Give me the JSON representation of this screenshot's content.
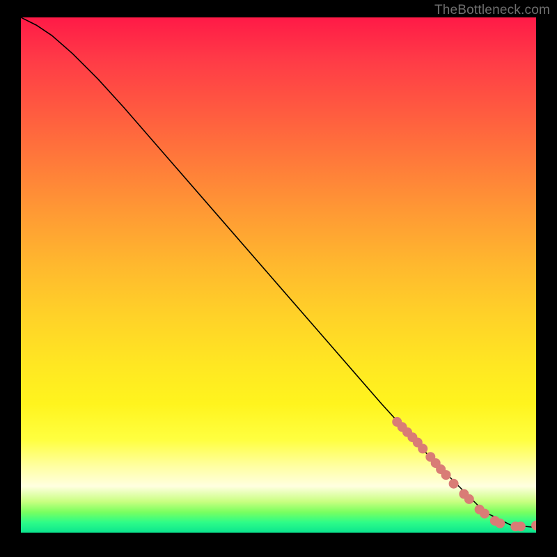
{
  "watermark": "TheBottleneck.com",
  "chart_data": {
    "type": "line",
    "title": "",
    "xlabel": "",
    "ylabel": "",
    "xlim": [
      0,
      100
    ],
    "ylim": [
      0,
      100
    ],
    "grid": false,
    "legend": false,
    "series": [
      {
        "name": "curve",
        "x": [
          0,
          3,
          6,
          10,
          15,
          20,
          30,
          40,
          50,
          60,
          70,
          80,
          90,
          95,
          100
        ],
        "y": [
          100,
          98.5,
          96.5,
          93,
          88,
          82.5,
          71,
          59.5,
          48,
          36.5,
          25,
          14,
          4,
          1.5,
          1
        ]
      }
    ],
    "points": [
      {
        "name": "cluster",
        "x": 73,
        "y": 21.5
      },
      {
        "name": "cluster",
        "x": 74,
        "y": 20.5
      },
      {
        "name": "cluster",
        "x": 75,
        "y": 19.5
      },
      {
        "name": "cluster",
        "x": 76,
        "y": 18.5
      },
      {
        "name": "cluster",
        "x": 77,
        "y": 17.5
      },
      {
        "name": "cluster",
        "x": 78,
        "y": 16.3
      },
      {
        "name": "cluster",
        "x": 79.5,
        "y": 14.7
      },
      {
        "name": "cluster",
        "x": 80.5,
        "y": 13.5
      },
      {
        "name": "cluster",
        "x": 81.5,
        "y": 12.3
      },
      {
        "name": "cluster",
        "x": 82.5,
        "y": 11.2
      },
      {
        "name": "cluster",
        "x": 84,
        "y": 9.5
      },
      {
        "name": "cluster",
        "x": 86,
        "y": 7.5
      },
      {
        "name": "cluster",
        "x": 87,
        "y": 6.5
      },
      {
        "name": "cluster",
        "x": 89,
        "y": 4.5
      },
      {
        "name": "cluster",
        "x": 90,
        "y": 3.7
      },
      {
        "name": "cluster",
        "x": 92,
        "y": 2.3
      },
      {
        "name": "cluster",
        "x": 93,
        "y": 1.8
      },
      {
        "name": "cluster",
        "x": 96,
        "y": 1.2
      },
      {
        "name": "cluster",
        "x": 97,
        "y": 1.2
      },
      {
        "name": "cluster",
        "x": 100,
        "y": 1.4
      }
    ],
    "colors": {
      "curve": "#000000",
      "points": "#d97c76"
    }
  }
}
